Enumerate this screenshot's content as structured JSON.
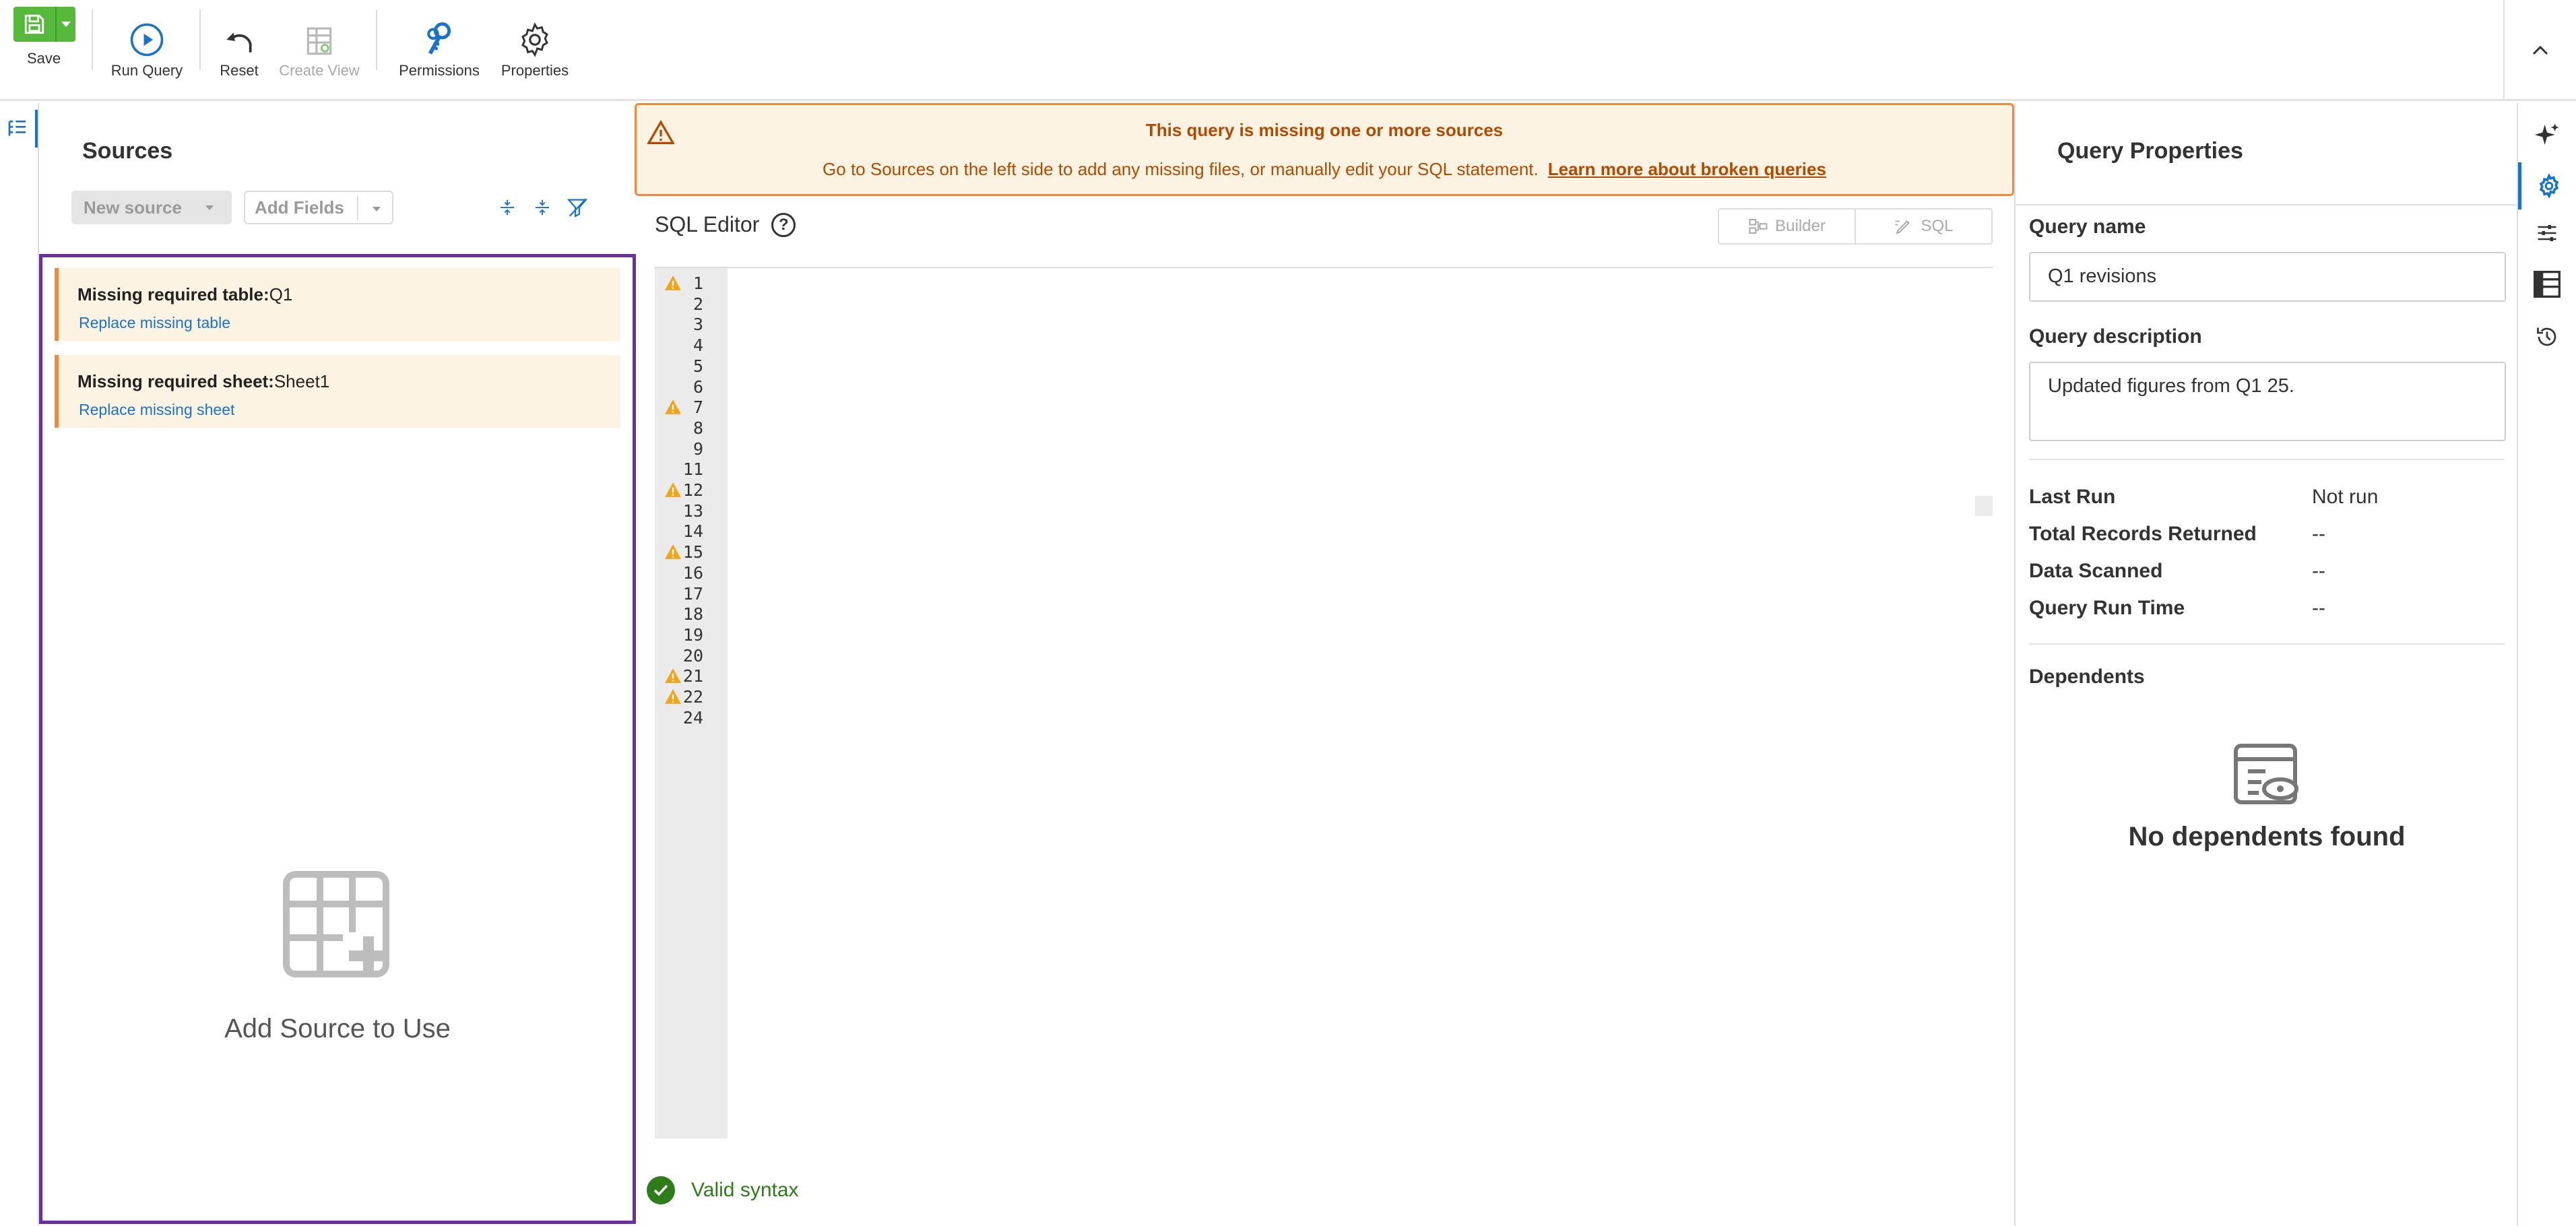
{
  "toolbar": {
    "save_label": "Save",
    "run_query_label": "Run Query",
    "reset_label": "Reset",
    "create_view_label": "Create View",
    "permissions_label": "Permissions",
    "properties_label": "Properties"
  },
  "sources": {
    "title": "Sources",
    "new_source_label": "New source",
    "add_fields_label": "Add Fields",
    "missing_items": [
      {
        "prefix": "Missing required table:",
        "name": "Q1",
        "action": "Replace missing table"
      },
      {
        "prefix": "Missing required sheet:",
        "name": "Sheet1",
        "action": "Replace missing sheet"
      }
    ],
    "empty_text": "Add Source to Use"
  },
  "banner": {
    "title": "This query is missing one or more sources",
    "message": "Go to Sources on the left side to add any missing files, or manually edit your SQL statement.",
    "link_text": "Learn more about broken queries"
  },
  "editor": {
    "title": "SQL Editor",
    "help": "?",
    "mode_builder": "Builder",
    "mode_sql": "SQL",
    "line_numbers": [
      "1",
      "2",
      "3",
      "4",
      "5",
      "6",
      "7",
      "8",
      "9",
      "11",
      "12",
      "13",
      "14",
      "15",
      "16",
      "17",
      "18",
      "19",
      "20",
      "21",
      "22",
      "24"
    ],
    "warning_lines": [
      "1",
      "7",
      "12",
      "15",
      "21",
      "22"
    ],
    "status": "Valid syntax"
  },
  "properties": {
    "title": "Query Properties",
    "query_name_label": "Query name",
    "query_name_value": "Q1 revisions",
    "query_description_label": "Query description",
    "query_description_value": "Updated figures from Q1 25.",
    "stats": [
      {
        "label": "Last Run",
        "value": "Not run"
      },
      {
        "label": "Total Records Returned",
        "value": "--"
      },
      {
        "label": "Data Scanned",
        "value": "--"
      },
      {
        "label": "Query Run Time",
        "value": "--"
      }
    ],
    "dependents_label": "Dependents",
    "no_dependents_text": "No dependents found"
  },
  "colors": {
    "accent_blue": "#1a73c7",
    "save_green": "#57b93b",
    "warning_orange": "#f08a3c",
    "warning_text": "#b34a00",
    "valid_green": "#2e7d1a",
    "selection_purple": "#6b2fa4"
  },
  "icons": {
    "save": "floppy-disk-icon",
    "run": "play-circle-icon",
    "reset": "undo-arrow-icon",
    "create_view": "view-table-icon",
    "permissions": "key-icon",
    "properties": "gear-icon",
    "collapse": "chevron-up-icon"
  }
}
